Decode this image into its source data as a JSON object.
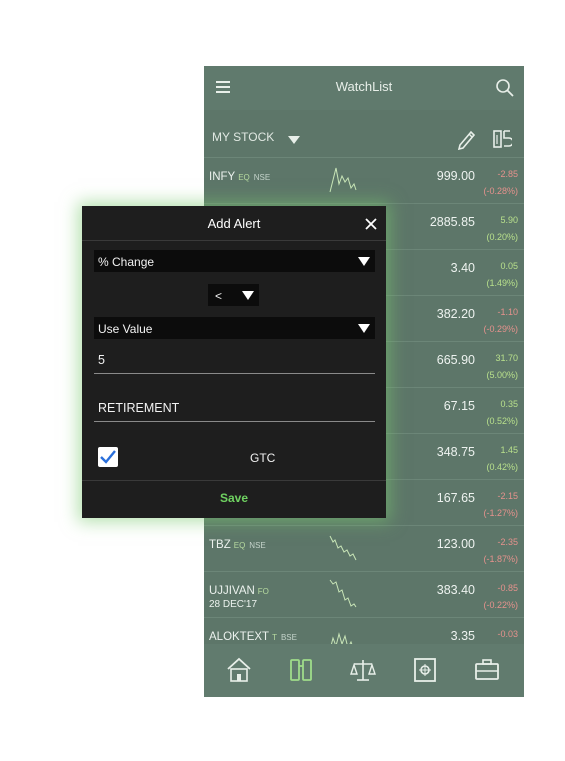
{
  "header": {
    "title": "WatchList"
  },
  "subbar": {
    "watchlist_name": "MY STOCK"
  },
  "stocks": [
    {
      "symbol": "INFY",
      "ex_code": "EQ",
      "exchange": "NSE",
      "date": "",
      "price": "999.00",
      "change": "-2.85",
      "pct": "(-0.28%)",
      "dir": "down"
    },
    {
      "symbol": "",
      "ex_code": "",
      "exchange": "",
      "date": "",
      "price": "2885.85",
      "change": "5.90",
      "pct": "(0.20%)",
      "dir": "up"
    },
    {
      "symbol": "",
      "ex_code": "",
      "exchange": "",
      "date": "",
      "price": "3.40",
      "change": "0.05",
      "pct": "(1.49%)",
      "dir": "up"
    },
    {
      "symbol": "",
      "ex_code": "",
      "exchange": "",
      "date": "",
      "price": "382.20",
      "change": "-1.10",
      "pct": "(-0.29%)",
      "dir": "down"
    },
    {
      "symbol": "",
      "ex_code": "",
      "exchange": "",
      "date": "",
      "price": "665.90",
      "change": "31.70",
      "pct": "(5.00%)",
      "dir": "up"
    },
    {
      "symbol": "",
      "ex_code": "",
      "exchange": "",
      "date": "",
      "price": "67.15",
      "change": "0.35",
      "pct": "(0.52%)",
      "dir": "up"
    },
    {
      "symbol": "",
      "ex_code": "",
      "exchange": "",
      "date": "",
      "price": "348.75",
      "change": "1.45",
      "pct": "(0.42%)",
      "dir": "up"
    },
    {
      "symbol": "",
      "ex_code": "",
      "exchange": "",
      "date": "",
      "price": "167.65",
      "change": "-2.15",
      "pct": "(-1.27%)",
      "dir": "down"
    },
    {
      "symbol": "TBZ",
      "ex_code": "EQ",
      "exchange": "NSE",
      "date": "",
      "price": "123.00",
      "change": "-2.35",
      "pct": "(-1.87%)",
      "dir": "down"
    },
    {
      "symbol": "UJJIVAN",
      "ex_code": "FO",
      "exchange": "",
      "date": "28 DEC'17",
      "price": "383.40",
      "change": "-0.85",
      "pct": "(-0.22%)",
      "dir": "down"
    },
    {
      "symbol": "ALOKTEXT",
      "ex_code": "T",
      "exchange": "BSE",
      "date": "",
      "price": "3.35",
      "change": "-0.03",
      "pct": "",
      "dir": "down"
    }
  ],
  "bottom_nav": [
    "home-icon",
    "binoculars-icon",
    "scales-icon",
    "safe-icon",
    "briefcase-icon"
  ],
  "dialog": {
    "title": "Add Alert",
    "type_select": "% Change",
    "operator_select": "<",
    "value_mode_select": "Use Value",
    "value_input": "5",
    "name_input": "RETIREMENT",
    "gtc_label": "GTC",
    "gtc_checked": true,
    "save_label": "Save"
  },
  "colors": {
    "app_bg": "#5d7669",
    "dialog_bg": "#1e1e1e",
    "accent_green": "#6fd261",
    "up": "#b8e08c",
    "down": "#e6928d"
  }
}
